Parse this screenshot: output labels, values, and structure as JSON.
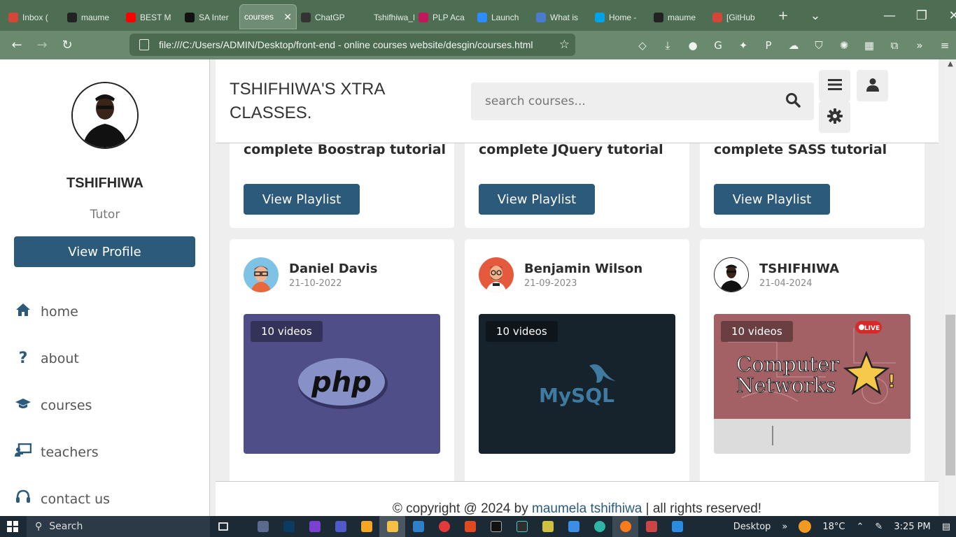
{
  "browser": {
    "tabs": [
      {
        "label": "Inbox (",
        "color": "#d44638"
      },
      {
        "label": "maume",
        "color": "#222"
      },
      {
        "label": "BEST M",
        "color": "#ff0000"
      },
      {
        "label": "SA Inter",
        "color": "#111"
      },
      {
        "label": "courses",
        "color": "",
        "active": true
      },
      {
        "label": "ChatGP",
        "color": "#333"
      },
      {
        "label": "Tshifhiwa_M",
        "color": ""
      },
      {
        "label": "PLP Aca",
        "color": "#c2185b"
      },
      {
        "label": "Launch",
        "color": "#2d8cff"
      },
      {
        "label": "What is",
        "color": "#4a7bd0"
      },
      {
        "label": "Home -",
        "color": "#00a2e8"
      },
      {
        "label": "maume",
        "color": "#222"
      },
      {
        "label": "[GitHub",
        "color": "#d44638"
      }
    ],
    "url": "file:///C:/Users/ADMIN/Desktop/front-end - online courses website/desgin/courses.html"
  },
  "sidebar": {
    "name": "TSHIFHIWA",
    "role": "Tutor",
    "profile_button": "View Profile",
    "nav": [
      {
        "label": "home",
        "icon": "home-icon"
      },
      {
        "label": "about",
        "icon": "question-icon"
      },
      {
        "label": "courses",
        "icon": "graduation-cap-icon"
      },
      {
        "label": "teachers",
        "icon": "chalkboard-teacher-icon"
      },
      {
        "label": "contact us",
        "icon": "headset-icon"
      }
    ]
  },
  "header": {
    "logo": "TSHIFHIWA'S XTRA CLASSES.",
    "search_placeholder": "search courses..."
  },
  "courses_top": [
    {
      "title": "complete Boostrap tutorial",
      "button": "View Playlist"
    },
    {
      "title": "complete JQuery tutorial",
      "button": "View Playlist"
    },
    {
      "title": "complete SASS tutorial",
      "button": "View Playlist"
    }
  ],
  "courses_bottom": [
    {
      "tutor": "Daniel Davis",
      "date": "21-10-2022",
      "videos": "10 videos",
      "thumb": "PHP logo",
      "thumb_text": "php"
    },
    {
      "tutor": "Benjamin Wilson",
      "date": "21-09-2023",
      "videos": "10 videos",
      "thumb": "MySQL logo",
      "thumb_text": "MySQL"
    },
    {
      "tutor": "TSHIFHIWA",
      "date": "21-04-2024",
      "videos": "10 videos",
      "thumb": "Computer Networks",
      "thumb_text": "Computer Networks",
      "live": "LIVE"
    }
  ],
  "footer": {
    "prefix": "© copyright @ 2024 by ",
    "author": "maumela tshifhiwa",
    "suffix": " | all rights reserved!"
  },
  "taskbar": {
    "search": "Search",
    "desktop": "Desktop",
    "temperature": "18°C",
    "time": "3:25 PM"
  },
  "colors": {
    "accent": "#2c5a7b",
    "browser_frame": "#4e6e53"
  }
}
